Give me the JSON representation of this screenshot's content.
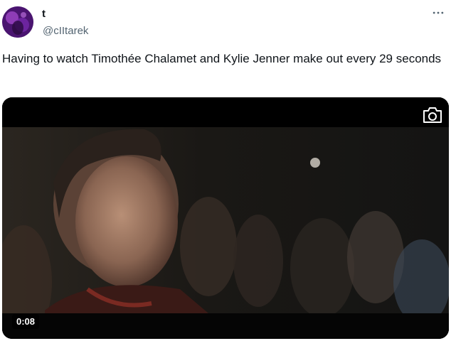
{
  "author": {
    "display_name": "t",
    "handle": "@cIItarek"
  },
  "tweet": {
    "text": "Having to watch Timothée Chalamet and Kylie Jenner make out every 29 seconds"
  },
  "media": {
    "type": "video",
    "duration": "0:08"
  },
  "icons": {
    "more": "more-icon",
    "camera": "camera-icon"
  },
  "colors": {
    "text_primary": "#0f1419",
    "text_secondary": "#536471"
  }
}
